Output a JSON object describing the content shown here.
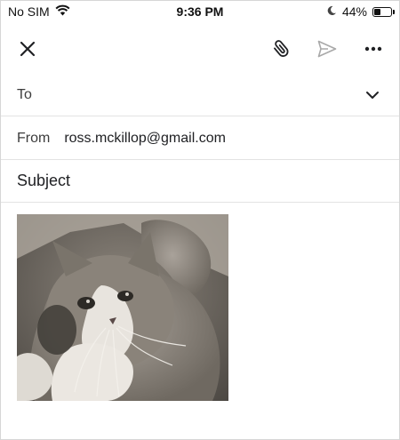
{
  "status_bar": {
    "carrier": "No SIM",
    "time": "9:36 PM",
    "battery_percent": "44%",
    "battery_level": 0.44,
    "icons": [
      "wifi-icon",
      "moon-icon",
      "battery-icon"
    ]
  },
  "toolbar": {
    "icons": [
      "close-icon",
      "paperclip-icon",
      "send-icon",
      "more-icon"
    ]
  },
  "compose": {
    "to_label": "To",
    "from_label": "From",
    "from_value": "ross.mckillop@gmail.com",
    "subject_placeholder": "Subject",
    "subject_value": ""
  },
  "attachment": {
    "type": "inline-image",
    "subject": "grey and white kitten"
  }
}
